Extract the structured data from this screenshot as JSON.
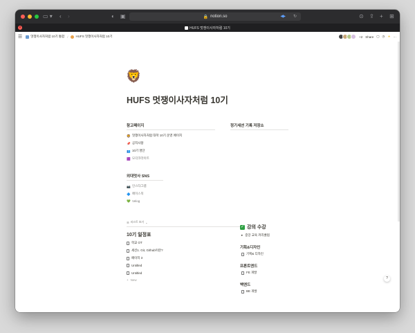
{
  "browser": {
    "url": "notion.so",
    "tab_title": "HUFS 멋쟁이사자처럼 10기"
  },
  "topbar": {
    "breadcrumb": [
      "멋쟁이사자처럼 10기 통합",
      "HUFS 멋쟁이사자처럼 10기"
    ],
    "avatar_count": "+2",
    "share_label": "Share"
  },
  "page": {
    "icon": "🦁",
    "title": "HUFS 멋쟁이사자처럼 10기"
  },
  "ref_section": {
    "heading": "참고페이지",
    "links": [
      {
        "icon": "🦁",
        "label": "멋쟁이사자처럼 대학 10기 운영 페이지"
      },
      {
        "icon": "📌",
        "label": "공지사항"
      },
      {
        "icon": "👥",
        "label": "10기 명단"
      },
      {
        "icon": "🟪",
        "label": "모각코라이트"
      }
    ]
  },
  "archive_section": {
    "heading": "정기세션 기록 저장소"
  },
  "sns_section": {
    "heading": "외대멋사 SNS",
    "links": [
      {
        "icon": "📷",
        "label": "인스타그램"
      },
      {
        "icon": "🔷",
        "label": "페이스북"
      },
      {
        "icon": "💚",
        "label": "Velog"
      }
    ]
  },
  "database": {
    "view_label": "리스트 보기",
    "title": "10기 일정표",
    "rows": [
      {
        "icon": "page",
        "label": "학교 OT"
      },
      {
        "icon": "page",
        "label": "세션1. Git, Github이란?"
      },
      {
        "icon": "page",
        "label": "페이지 3"
      },
      {
        "icon": "page",
        "label": "Untitled"
      },
      {
        "icon": "page",
        "label": "Untitled"
      }
    ],
    "new_label": "New"
  },
  "lecture": {
    "title": "강의 수강",
    "toggle": "중앙 교육 커리큘럼",
    "groups": [
      {
        "heading": "기획&디자인",
        "link": "기획& 디자인"
      },
      {
        "heading": "프론트엔드",
        "link": "FE 개발"
      },
      {
        "heading": "백엔드",
        "link": "BE 개발"
      }
    ]
  },
  "help_label": "?"
}
